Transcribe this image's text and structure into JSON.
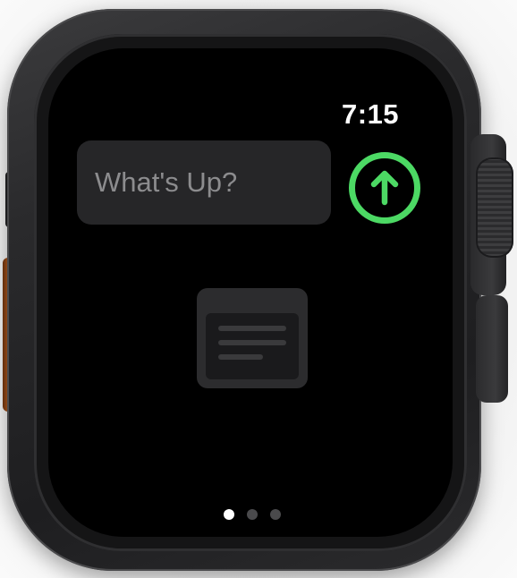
{
  "status_bar": {
    "time": "7:15"
  },
  "compose": {
    "placeholder": "What's Up?",
    "send_icon": "arrow-up-circle-icon",
    "accent_color": "#4cd964"
  },
  "content": {
    "icon": "document-lines-icon"
  },
  "pagination": {
    "total_pages": 3,
    "current_page": 1
  }
}
